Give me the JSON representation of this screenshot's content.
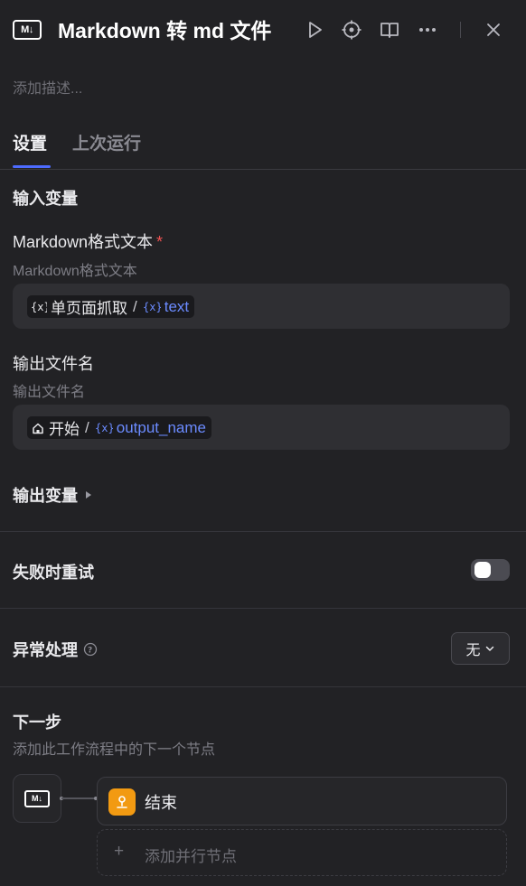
{
  "header": {
    "logo_text": "M↓",
    "title": "Markdown 转 md 文件",
    "icons": [
      "play-icon",
      "locate-icon",
      "book-icon",
      "more-icon",
      "close-icon"
    ]
  },
  "description_placeholder": "添加描述...",
  "tabs": [
    {
      "label": "设置",
      "active": true
    },
    {
      "label": "上次运行",
      "active": false
    }
  ],
  "input_section": {
    "title": "输入变量",
    "fields": [
      {
        "label": "Markdown格式文本",
        "required_mark": "*",
        "description": "Markdown格式文本",
        "source_node": "单页面抓取",
        "separator": "/",
        "variable": "text",
        "source_icon": "variable-icon"
      },
      {
        "label": "输出文件名",
        "description": "输出文件名",
        "source_node": "开始",
        "separator": "/",
        "variable": "output_name",
        "source_icon": "home-icon"
      }
    ]
  },
  "output_section": {
    "title": "输出变量"
  },
  "retry": {
    "label": "失败时重试",
    "enabled": false
  },
  "error_handling": {
    "label": "异常处理",
    "value": "无"
  },
  "next_step": {
    "title": "下一步",
    "description": "添加此工作流程中的下一个节点",
    "end_node_label": "结束",
    "add_parallel_label": "添加并行节点",
    "add_plus": "+"
  },
  "colors": {
    "background": "#222225",
    "accent": "#4d6bfe",
    "variable": "#6b8bff",
    "end_node": "#f29a12",
    "required": "#f05252"
  }
}
